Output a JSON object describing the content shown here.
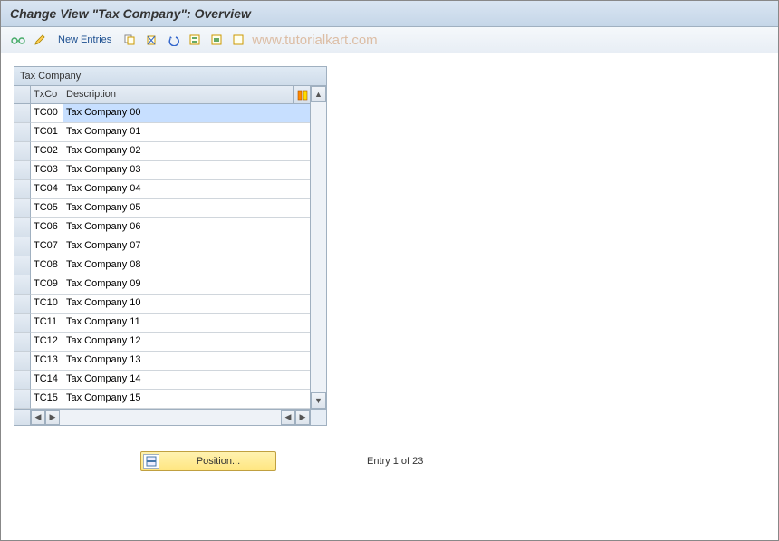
{
  "header": {
    "title": "Change View \"Tax Company\": Overview"
  },
  "toolbar": {
    "new_entries_label": "New Entries"
  },
  "watermark": "www.tutorialkart.com",
  "table": {
    "panel_title": "Tax Company",
    "col_txco": "TxCo",
    "col_desc": "Description",
    "rows": [
      {
        "code": "TC00",
        "desc": "Tax  Company 00",
        "selected": true
      },
      {
        "code": "TC01",
        "desc": "Tax  Company 01"
      },
      {
        "code": "TC02",
        "desc": "Tax  Company 02"
      },
      {
        "code": "TC03",
        "desc": "Tax  Company 03"
      },
      {
        "code": "TC04",
        "desc": "Tax  Company 04"
      },
      {
        "code": "TC05",
        "desc": "Tax  Company 05"
      },
      {
        "code": "TC06",
        "desc": "Tax  Company 06"
      },
      {
        "code": "TC07",
        "desc": "Tax  Company 07"
      },
      {
        "code": "TC08",
        "desc": "Tax  Company 08"
      },
      {
        "code": "TC09",
        "desc": "Tax  Company 09"
      },
      {
        "code": "TC10",
        "desc": "Tax  Company 10"
      },
      {
        "code": "TC11",
        "desc": "Tax  Company 11"
      },
      {
        "code": "TC12",
        "desc": "Tax  Company 12"
      },
      {
        "code": "TC13",
        "desc": "Tax  Company 13"
      },
      {
        "code": "TC14",
        "desc": "Tax  Company 14"
      },
      {
        "code": "TC15",
        "desc": "Tax  Company 15"
      }
    ]
  },
  "footer": {
    "position_label": "Position...",
    "entry_status": "Entry 1 of 23"
  },
  "icons": {
    "glasses": "glasses-icon",
    "pencil": "pencil-icon",
    "copy": "copy-icon",
    "delete": "delete-icon",
    "undo": "undo-icon",
    "select_all": "select-all-icon",
    "select_block": "select-block-icon",
    "deselect": "deselect-icon",
    "config": "table-settings-icon"
  }
}
